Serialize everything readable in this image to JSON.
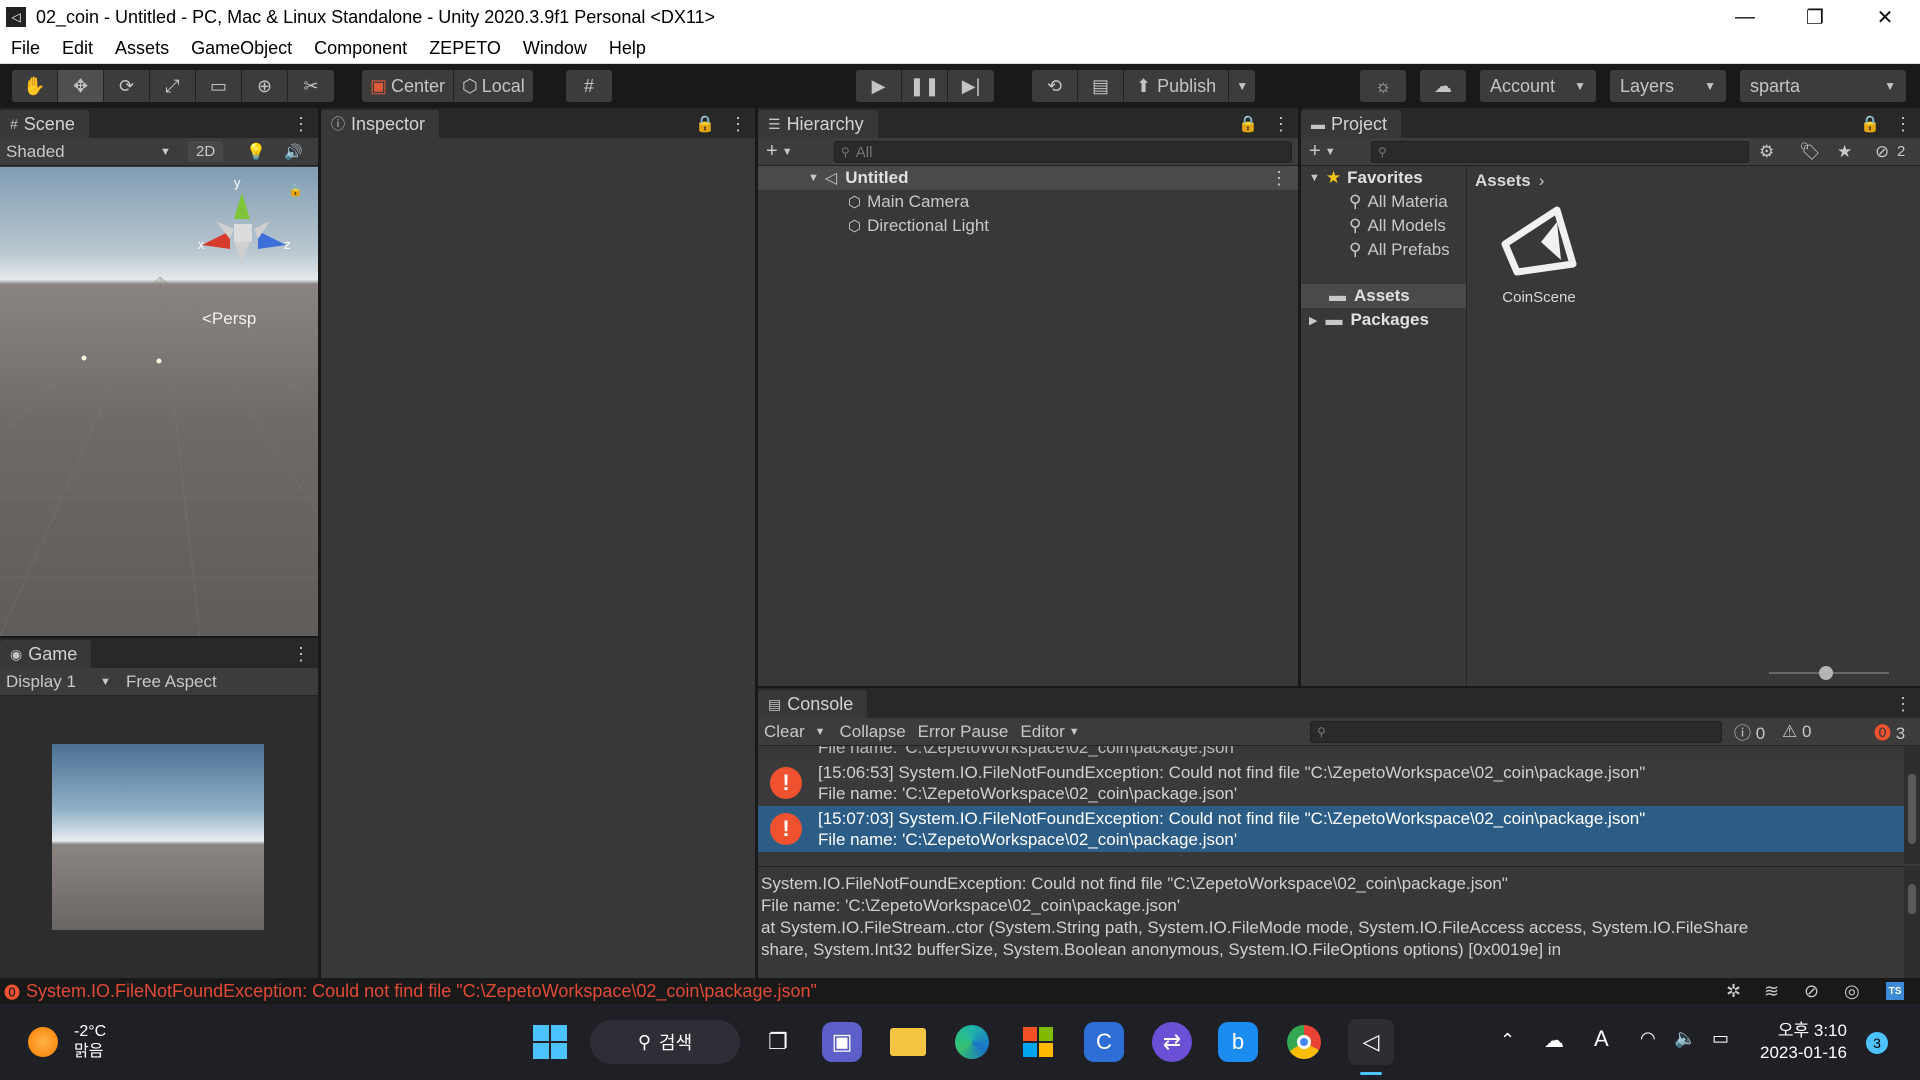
{
  "window": {
    "title": "02_coin - Untitled - PC, Mac & Linux Standalone - Unity 2020.3.9f1 Personal <DX11>",
    "controls": [
      "—",
      "❐",
      "✕"
    ]
  },
  "menu": [
    "File",
    "Edit",
    "Assets",
    "GameObject",
    "Component",
    "ZEPETO",
    "Window",
    "Help"
  ],
  "toolbar": {
    "pivot_center": "Center",
    "pivot_local": "Local",
    "publish": "Publish",
    "account": "Account",
    "layers": "Layers",
    "layout": "sparta"
  },
  "scene": {
    "tab": "Scene",
    "shading": "Shaded",
    "mode_2d": "2D",
    "persp_label": "<Persp",
    "gizmo_y": "y",
    "gizmo_x": "x",
    "gizmo_z": "z"
  },
  "game": {
    "tab": "Game",
    "display": "Display 1",
    "aspect": "Free Aspect"
  },
  "inspector": {
    "tab": "Inspector"
  },
  "hierarchy": {
    "tab": "Hierarchy",
    "search_placeholder": "All",
    "scene_name": "Untitled",
    "items": [
      "Main Camera",
      "Directional Light"
    ]
  },
  "project": {
    "tab": "Project",
    "favorites_label": "Favorites",
    "favorites": [
      "All Materia",
      "All Models",
      "All Prefabs"
    ],
    "folders": [
      "Assets",
      "Packages"
    ],
    "breadcrumb": "Assets",
    "asset_name": "CoinScene",
    "hidden_count": "2"
  },
  "console": {
    "tab": "Console",
    "clear": "Clear",
    "collapse": "Collapse",
    "error_pause": "Error Pause",
    "editor": "Editor",
    "log_count": "0",
    "warning_count": "0",
    "error_count": "3",
    "partial_line": "File name: 'C:\\ZepetoWorkspace\\02_coin\\package.json'",
    "entries": [
      {
        "line1": "[15:06:53] System.IO.FileNotFoundException: Could not find file \"C:\\ZepetoWorkspace\\02_coin\\package.json\"",
        "line2": "File name: 'C:\\ZepetoWorkspace\\02_coin\\package.json'"
      },
      {
        "line1": "[15:07:03] System.IO.FileNotFoundException: Could not find file \"C:\\ZepetoWorkspace\\02_coin\\package.json\"",
        "line2": "File name: 'C:\\ZepetoWorkspace\\02_coin\\package.json'"
      }
    ],
    "detail": [
      "System.IO.FileNotFoundException: Could not find file \"C:\\ZepetoWorkspace\\02_coin\\package.json\"",
      "File name: 'C:\\ZepetoWorkspace\\02_coin\\package.json'",
      "  at System.IO.FileStream..ctor (System.String path, System.IO.FileMode mode, System.IO.FileAccess access, System.IO.FileShare",
      "share, System.Int32 bufferSize, System.Boolean anonymous, System.IO.FileOptions options) [0x0019e] in"
    ]
  },
  "status": {
    "message": "System.IO.FileNotFoundException: Could not find file \"C:\\ZepetoWorkspace\\02_coin\\package.json\""
  },
  "taskbar": {
    "weather_temp": "-2°C",
    "weather_desc": "맑음",
    "search_label": "검색",
    "time": "오후 3:10",
    "date": "2023-01-16",
    "notification_count": "3"
  },
  "colors": {
    "selection": "#2c5d87",
    "error": "#f0512f",
    "accent_blue": "#3d8bd6"
  }
}
